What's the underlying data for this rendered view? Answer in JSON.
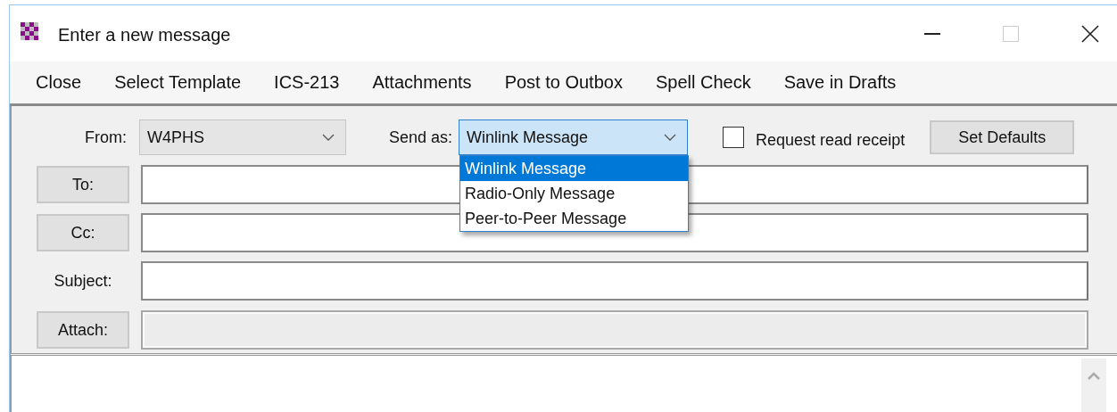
{
  "window": {
    "title": "Enter a new message"
  },
  "menu": [
    "Close",
    "Select Template",
    "ICS-213",
    "Attachments",
    "Post to Outbox",
    "Spell Check",
    "Save in Drafts"
  ],
  "from": {
    "label": "From:",
    "value": "W4PHS"
  },
  "send_as": {
    "label": "Send as:",
    "value": "Winlink Message",
    "expanded": true,
    "options": [
      {
        "label": "Winlink Message",
        "selected": true
      },
      {
        "label": "Radio-Only Message",
        "selected": false
      },
      {
        "label": "Peer-to-Peer Message",
        "selected": false
      }
    ]
  },
  "read_receipt": {
    "label": "Request read receipt",
    "checked": false
  },
  "set_defaults": "Set Defaults",
  "fields": [
    {
      "label": "To:",
      "kind": "button",
      "disabled": false
    },
    {
      "label": "Cc:",
      "kind": "button",
      "disabled": false
    },
    {
      "label": "Subject:",
      "kind": "text",
      "disabled": false
    },
    {
      "label": "Attach:",
      "kind": "button",
      "disabled": true
    }
  ]
}
